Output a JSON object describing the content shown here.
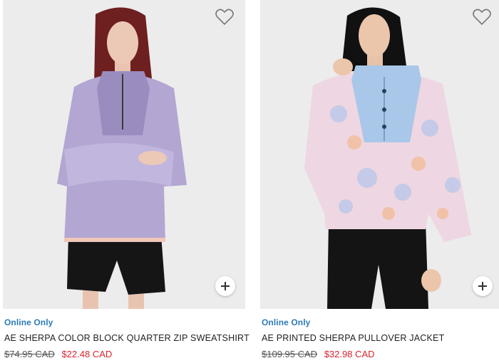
{
  "products": [
    {
      "badge": "Online Only",
      "name": "AE SHERPA COLOR BLOCK QUARTER ZIP SWEATSHIRT",
      "original_price": "$74.95 CAD",
      "sale_price": "$22.48 CAD",
      "colors": {
        "sweater": "#b3a6d2",
        "sweater_dark": "#9a8cbf",
        "shorts": "#151515",
        "hair": "#6e1f1f"
      }
    },
    {
      "badge": "Online Only",
      "name": "AE PRINTED SHERPA PULLOVER JACKET",
      "original_price": "$109.95 CAD",
      "sale_price": "$32.98 CAD",
      "colors": {
        "jacket": "#eed6e2",
        "panel": "#a9c7e8",
        "pants": "#141414",
        "hair": "#111111"
      }
    }
  ],
  "icons": {
    "favorite": "heart-outline-icon",
    "quick_add": "plus-icon"
  },
  "colors": {
    "badge": "#2c7bb6",
    "sale": "#d9232e",
    "image_bg": "#ebebeb"
  }
}
